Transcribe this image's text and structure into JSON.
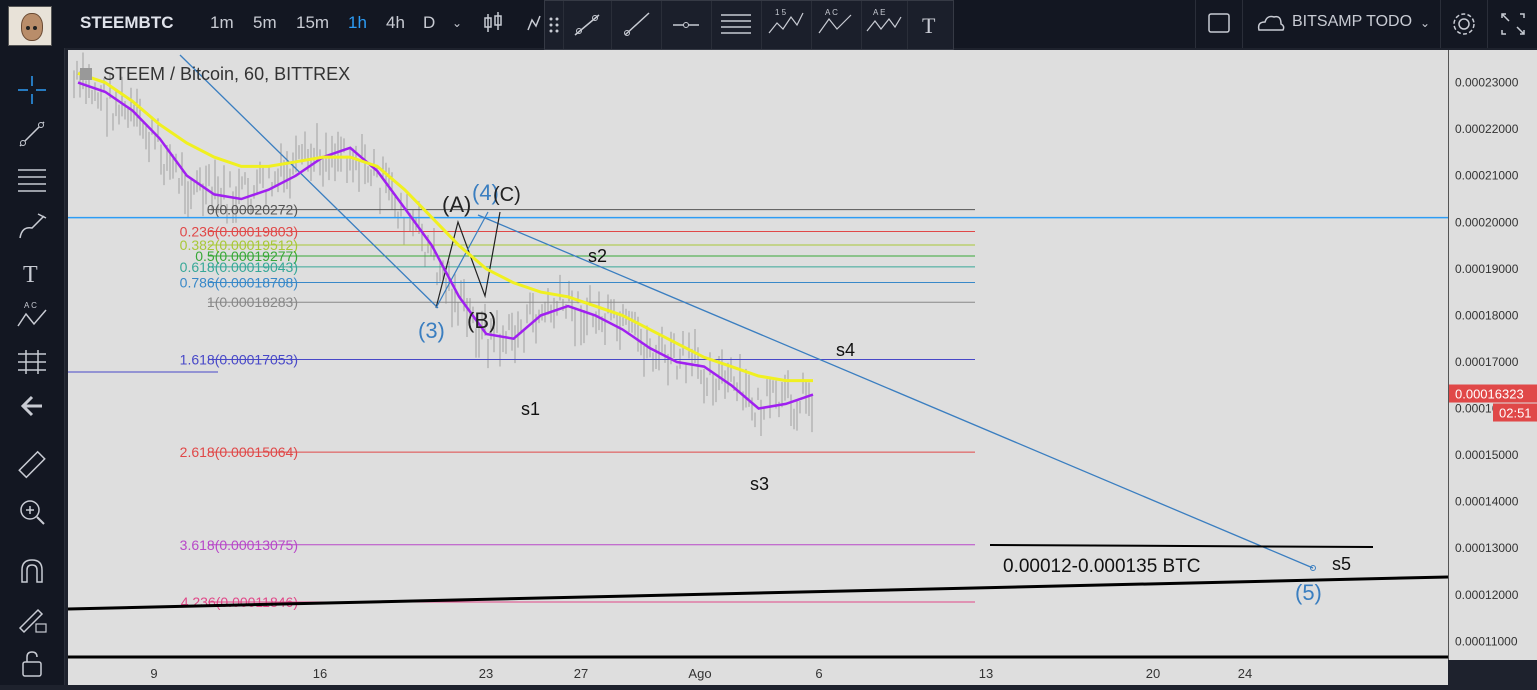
{
  "header": {
    "symbol": "STEEMBTC",
    "timeframes": [
      {
        "label": "1m",
        "active": false
      },
      {
        "label": "5m",
        "active": false
      },
      {
        "label": "15m",
        "active": false
      },
      {
        "label": "1h",
        "active": true
      },
      {
        "label": "4h",
        "active": false
      },
      {
        "label": "D",
        "active": false
      }
    ],
    "layout_name": "BITSAMP TODO"
  },
  "drawing_toolbar": {
    "tools": [
      "trend-line-icon",
      "ray-icon",
      "horizontal-line-icon",
      "pitchfork-icon",
      "elliott-impulse-icon",
      "abc-correction-icon",
      "triangle-wave-icon",
      "text-icon"
    ],
    "wave_labels": [
      "1 5",
      "A C",
      "A E"
    ]
  },
  "sidebar": {
    "tools": [
      "crosshair-icon",
      "trendline-icon",
      "fib-retracement-icon",
      "brush-icon",
      "text-tool-icon",
      "pattern-icon",
      "prediction-icon",
      "back-arrow-icon",
      "ruler-icon",
      "zoom-icon",
      "magnet-icon",
      "lock-drawing-icon",
      "lock-icon"
    ]
  },
  "chart_data": {
    "type": "line",
    "legend_title": "STEEM / Bitcoin, 60, BITTREX",
    "x_ticks": [
      "9",
      "16",
      "23",
      "27",
      "Ago",
      "6",
      "13",
      "20",
      "24"
    ],
    "y_ticks": [
      "0.00023000",
      "0.00022000",
      "0.00021000",
      "0.00020000",
      "0.00019000",
      "0.00018000",
      "0.00017000",
      "0.00016000",
      "0.00015000",
      "0.00014000",
      "0.00013000",
      "0.00012000",
      "0.00011000"
    ],
    "ylim": [
      0.000106,
      0.000237
    ],
    "current_price": "0.00016323",
    "countdown": "02:51",
    "horizontal_line": 0.000201,
    "fib_levels": [
      {
        "label": "0(0.00020272)",
        "value": 0.00020272,
        "color": "#555555"
      },
      {
        "label": "0.236(0.00019803)",
        "value": 0.00019803,
        "color": "#e04848"
      },
      {
        "label": "0.382(0.00019512)",
        "value": 0.00019512,
        "color": "#a8c838"
      },
      {
        "label": "0.5(0.00019277)",
        "value": 0.00019277,
        "color": "#38a838"
      },
      {
        "label": "0.618(0.00019043)",
        "value": 0.00019043,
        "color": "#38a898"
      },
      {
        "label": "0.786(0.00018708)",
        "value": 0.00018708,
        "color": "#3888c8"
      },
      {
        "label": "1(0.00018283)",
        "value": 0.00018283,
        "color": "#888888"
      },
      {
        "label": "1.618(0.00017053)",
        "value": 0.00017053,
        "color": "#4848c8"
      },
      {
        "label": "2.618(0.00015064)",
        "value": 0.00015064,
        "color": "#e04848"
      },
      {
        "label": "3.618(0.00013075)",
        "value": 0.00013075,
        "color": "#b848c8"
      },
      {
        "label": "4.236(0.00011846)",
        "value": 0.00011846,
        "color": "#e04888"
      }
    ],
    "wave_labels": [
      "(A)",
      "(4)",
      "(C)",
      "(3)",
      "(B)",
      "(5)"
    ],
    "swing_labels": [
      "s1",
      "s2",
      "s3",
      "s4",
      "s5"
    ],
    "annotation": "0.00012-0.000135 BTC",
    "series": [
      {
        "color": "#a020f0",
        "values": [
          0.00023,
          0.000228,
          0.000224,
          0.000218,
          0.00021,
          0.000206,
          0.000205,
          0.000207,
          0.00021,
          0.000214,
          0.000216,
          0.000211,
          0.000203,
          0.000195,
          0.000184,
          0.000176,
          0.000175,
          0.00018,
          0.000182,
          0.00018,
          0.000177,
          0.000173,
          0.00017,
          0.000169,
          0.000165,
          0.00016,
          0.000161,
          0.000163
        ]
      },
      {
        "color": "#f0f020",
        "values": [
          0.000232,
          0.00023,
          0.000226,
          0.000221,
          0.000217,
          0.000214,
          0.000212,
          0.000212,
          0.000213,
          0.000214,
          0.000214,
          0.000212,
          0.000207,
          0.000201,
          0.000195,
          0.00019,
          0.000187,
          0.000185,
          0.000184,
          0.000182,
          0.00018,
          0.000177,
          0.000174,
          0.000171,
          0.000169,
          0.000167,
          0.000166,
          0.000166
        ]
      }
    ]
  },
  "colors": {
    "toolbar_bg": "#131722",
    "chart_bg": "#dedede",
    "accent_blue": "#2c9cf5",
    "price_tag": "#e04848"
  }
}
